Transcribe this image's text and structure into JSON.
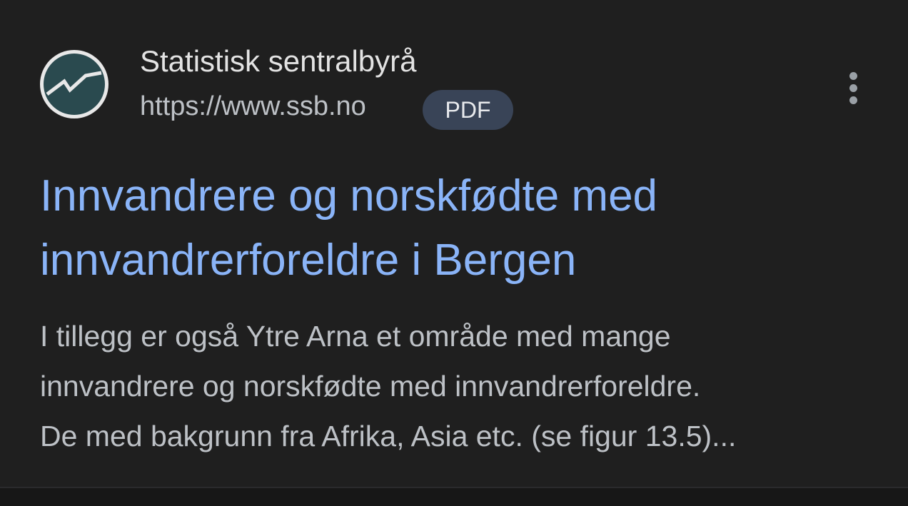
{
  "result": {
    "site_name": "Statistisk sentralbyrå",
    "url": "https://www.ssb.no",
    "badge": "PDF",
    "favicon_icon": "ssb-logo-icon",
    "title_line1": "Innvandrere og norskfødte med",
    "title_line2": "innvandrerforeldre i Bergen",
    "snippet_line1": "I tillegg er også Ytre Arna et område med mange",
    "snippet_line2": "innvandrere og norskfødte med innvandrerforeldre.",
    "snippet_line3": "De med bakgrunn fra Afrika, Asia etc. (se figur 13.5)...",
    "more_icon": "more-vert-icon"
  },
  "colors": {
    "background": "#1f1f1f",
    "title_link": "#8ab4f8",
    "text_primary": "#e3e3e3",
    "text_secondary": "#bdc1c6",
    "badge_bg": "#394457",
    "logo_teal": "#2a4a4f"
  }
}
